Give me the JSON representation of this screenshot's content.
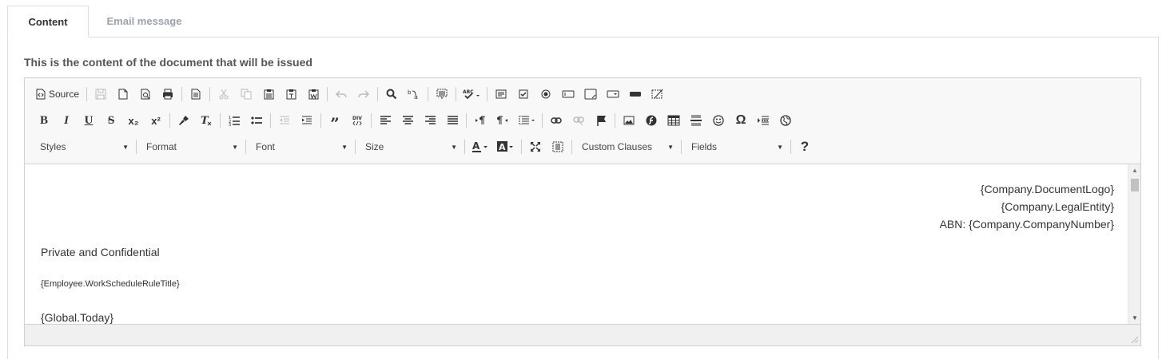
{
  "tabs": [
    {
      "label": "Content",
      "active": true
    },
    {
      "label": "Email message",
      "active": false
    }
  ],
  "section_label": "This is the content of the document that will be issued",
  "toolbar": {
    "source_label": "Source",
    "styles_combo": "Styles",
    "format_combo": "Format",
    "font_combo": "Font",
    "size_combo": "Size",
    "custom_clauses_combo": "Custom Clauses",
    "fields_combo": "Fields",
    "help_label": "?",
    "bold_label": "B",
    "italic_label": "I",
    "underline_label": "U",
    "strike_label": "S",
    "subscript_label": "x₂",
    "superscript_label": "x²",
    "omega_label": "Ω"
  },
  "content": {
    "logo_line": "{Company.DocumentLogo}",
    "legal_line": "{Company.LegalEntity}",
    "abn_line": "ABN: {Company.CompanyNumber}",
    "private_line": "Private and Confidential",
    "schedule_line": "{Employee.WorkScheduleRuleTitle}",
    "today_line": "{Global.Today}"
  },
  "colors": {
    "inactive_tab": "#9aa3ad",
    "toolbar_bg": "#f8f8f8",
    "border": "#d1d1d1"
  }
}
